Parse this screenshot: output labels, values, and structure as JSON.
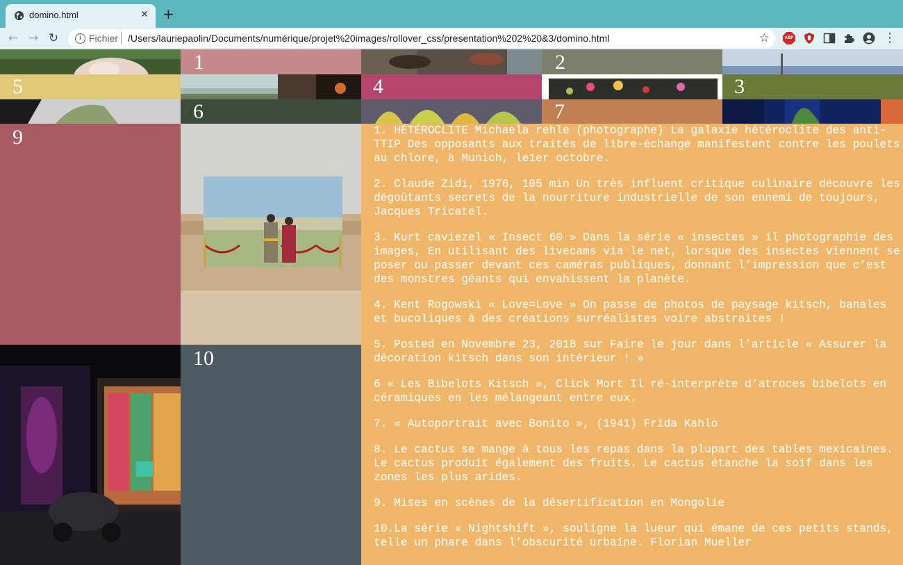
{
  "browser": {
    "tab_title": "domino.html",
    "tab_close": "✕",
    "new_tab": "+",
    "url_scheme": "Fichier",
    "url": "/Users/lauriepaolin/Documents/numérique/projet%20images/rollover_css/presentation%202%20&3/domino.html",
    "extensions": [
      "adblock-plus-icon",
      "ublock-icon",
      "reader-icon",
      "puzzle-icon",
      "profile-icon"
    ],
    "abp_label": "ABP"
  },
  "grid": {
    "cell_numbers": {
      "n1": "1",
      "n2": "2",
      "n3": "3",
      "n4": "4",
      "n5": "5",
      "n6": "6",
      "n7": "7",
      "n9": "9",
      "n10": "10"
    },
    "colors": {
      "pink": "#c58b8b",
      "olive_gray": "#7c7f6b",
      "yellow": "#e2c879",
      "magenta": "#b6456d",
      "green": "#6b7a38",
      "dark_green": "#3e4a3b",
      "terracotta": "#c08051",
      "rose": "#a75b62",
      "slate": "#4d5a61",
      "panel": "#efb66a"
    }
  },
  "captions": [
    "1. HÉTÉROCLITE Michaela rehle (photographe) La galaxie hétéroclite des anti-TTIP Des opposants aux traités de libre-échange manifestent contre les poulets au chlore, à Munich, le1er octobre.",
    "2. Claude Zidi, 1976, 105 min Un très influent critique culinaire découvre les dégoûtants secrets de la nourriture industrielle de son ennemi de toujours, Jacques Tricatel.",
    "3. Kurt caviezel « Insect 60 » Dans la série « insectes » il photographie des images, En utilisant des livecams via le net, lorsque des insectes viennent se poser ou passer devant ces caméras publiques, donnant l’impression que c’est des monstres géants qui envahissent la planète.",
    "4. Kent Rogowski « Love=Love » On passe de photos de paysage kitsch, banales et bucoliques à des créations surréalistes voire abstraites !",
    "5. Posted en Novembre 23, 2018 sur Faire le jour dans l’article « Assurer la décoration kitsch dans son intérieur ! »",
    "6 « Les Bibelots Kitsch », Click Mort Il ré-interprète d’atroces bibelots en céramiques en les mélangeant entre eux.",
    "7. « Autoportrait avec Bonito », (1941) Frida Kahlo",
    "8. Le cactus se mange à tous les repas dans la plupart des tables mexicaines. Le cactus produit également des fruits. Le cactus étanche la soif dans les zones les plus arides.",
    "9. Mises en scènes de la désertification en Mongolie",
    "10.La série « Nightshift », souligne la lueur qui émane de ces petits stands, telle un phare dans l’obscurité urbaine. Florian Mueller"
  ]
}
